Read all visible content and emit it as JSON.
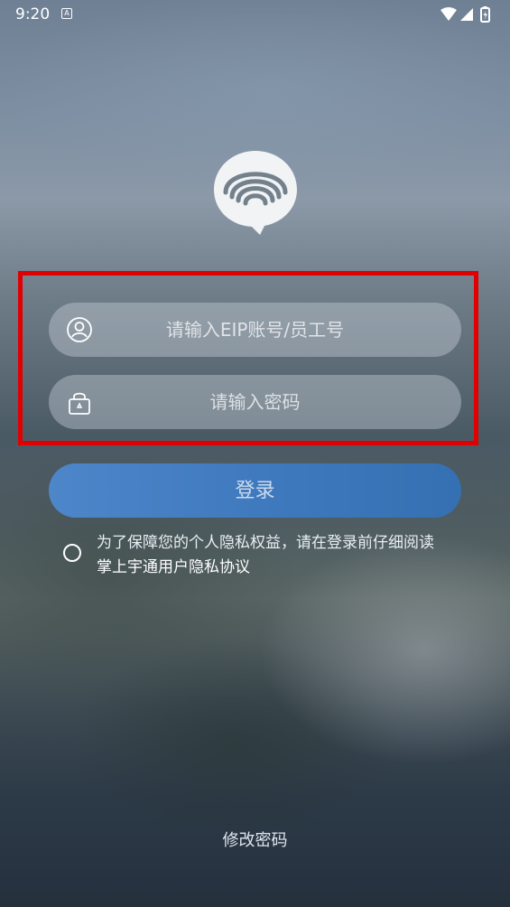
{
  "status_bar": {
    "time": "9:20",
    "notification_icon_letter": "A",
    "icons": [
      "wifi-icon",
      "signal-icon",
      "battery-icon"
    ]
  },
  "logo": {
    "icon": "chat-bubble-signal-logo"
  },
  "login_form": {
    "account_placeholder": "请输入EIP账号/员工号",
    "password_placeholder": "请输入密码",
    "account_icon": "user-icon",
    "password_icon": "lock-icon",
    "highlight_color": "#e00000"
  },
  "login_button": {
    "label": "登录",
    "color": "#4080c4"
  },
  "agreement": {
    "checked": false,
    "text": "为了保障您的个人隐私权益，请在登录前仔细阅读",
    "link_text": "掌上宇通用户隐私协议"
  },
  "footer": {
    "change_password_label": "修改密码"
  }
}
